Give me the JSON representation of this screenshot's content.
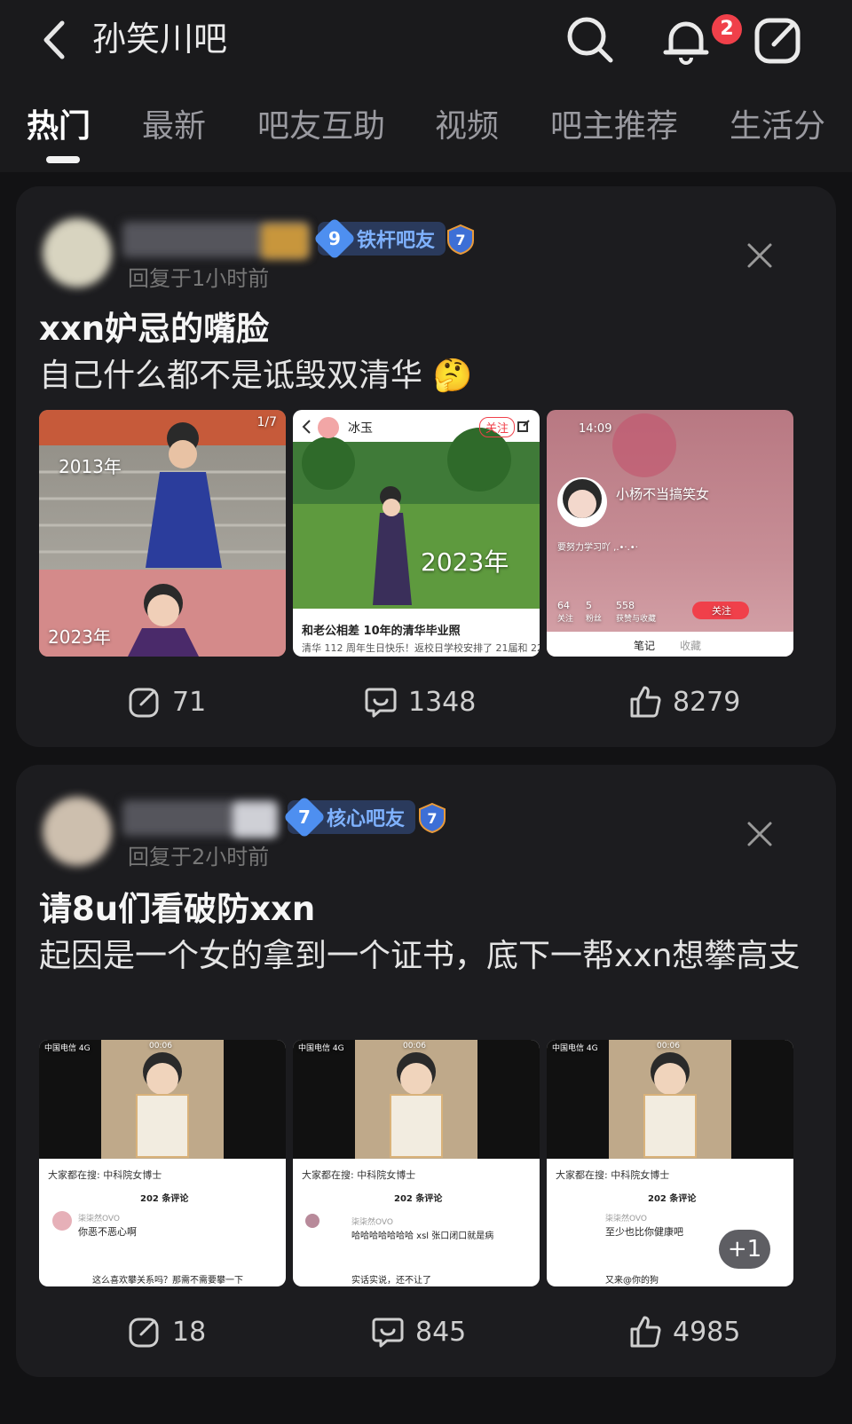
{
  "header": {
    "title": "孙笑川吧",
    "notification_badge": "2",
    "icons": [
      "back-icon",
      "search-icon",
      "bell-icon",
      "edit-icon"
    ]
  },
  "tabs": [
    "热门",
    "最新",
    "吧友互助",
    "视频",
    "吧主推荐",
    "生活分"
  ],
  "active_tab": 0,
  "posts": [
    {
      "level": "9",
      "level_label": "铁杆吧友",
      "shield_level": "7",
      "meta": "回复于1小时前",
      "title": "xxn妒忌的嘴脸",
      "body": "自己什么都不是诋毁双清华 🤔",
      "images": [
        {
          "corner": "1/7",
          "top_year": "2013年",
          "bottom_year": "2023年"
        },
        {
          "user": "冰玉",
          "follow": "关注",
          "year": "2023年",
          "caption": "和老公相差 10年的清华毕业照",
          "sub": "清华 112 周年生日快乐！返校日学校安排了 21届和 22"
        },
        {
          "time": "14:09",
          "name": "小杨不当搞笑女",
          "bio": "要努力学习吖 ,.•·.•·",
          "stats": [
            "64",
            "5",
            "558"
          ],
          "stat_labels": [
            "关注",
            "粉丝",
            "获赞与收藏"
          ],
          "follow": "关注",
          "tab_a": "笔记",
          "tab_b": "收藏"
        }
      ],
      "stats": {
        "shares": "71",
        "comments": "1348",
        "likes": "8279"
      }
    },
    {
      "level": "7",
      "level_label": "核心吧友",
      "shield_level": "7",
      "meta": "回复于2小时前",
      "title": "请8u们看破防xxn",
      "body": "起因是一个女的拿到一个证书，底下一帮xxn想攀高支",
      "images": [
        {
          "carrier": "中国电信 4G",
          "time": "00:06",
          "search": "大家都在搜: 中科院女博士",
          "count": "202 条评论",
          "user": "柒柒然OVO",
          "comment": "你恶不恶心啊",
          "extra": "这么喜欢攀关系吗？那需不需要攀一下"
        },
        {
          "carrier": "中国电信 4G",
          "time": "00:06",
          "search": "大家都在搜: 中科院女博士",
          "count": "202 条评论",
          "user": "柒柒然OVO",
          "comment": "哈哈哈哈哈哈哈 xsl 张口闭口就是病",
          "extra": "实话实说，还不让了"
        },
        {
          "carrier": "中国电信 4G",
          "time": "00:06",
          "search": "大家都在搜: 中科院女博士",
          "count": "202 条评论",
          "user": "柒柒然OVO",
          "comment": "至少也比你健康吧",
          "extra": "又来@你的狗"
        }
      ],
      "more_badge": "+1",
      "stats": {
        "shares": "18",
        "comments": "845",
        "likes": "4985"
      }
    }
  ],
  "colors": {
    "background": "#121214",
    "card": "#1c1c1f",
    "badge_red": "#f0404a",
    "level_blue": "#4e8ff0"
  }
}
